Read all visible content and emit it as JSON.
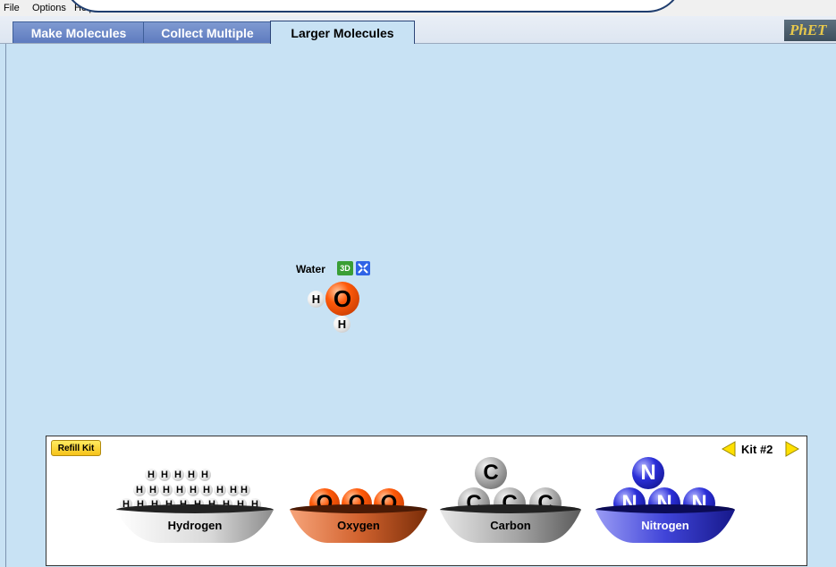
{
  "menu": {
    "file": "File",
    "options": "Options",
    "help": "Help"
  },
  "tabs": [
    {
      "label": "Make Molecules"
    },
    {
      "label": "Collect Multiple"
    },
    {
      "label": "Larger Molecules"
    }
  ],
  "brand": "PhET",
  "molecule": {
    "name": "Water",
    "button_3d": "3D",
    "center_atom": "O",
    "side_atom_1": "H",
    "side_atom_2": "H"
  },
  "kit": {
    "refill_label": "Refill Kit",
    "kit_label": "Kit #2",
    "bins": [
      {
        "label": "Hydrogen",
        "symbol": "H",
        "color": "#e0e0e0"
      },
      {
        "label": "Oxygen",
        "symbol": "O",
        "color": "#e05a1c"
      },
      {
        "label": "Carbon",
        "symbol": "C",
        "color": "#9a9a9a"
      },
      {
        "label": "Nitrogen",
        "symbol": "N",
        "color": "#2b2fc9"
      }
    ]
  },
  "colors": {
    "background": "#c8e2f4",
    "tab_active": "#c8e2f4",
    "tab_inactive": "#6a86c6"
  }
}
